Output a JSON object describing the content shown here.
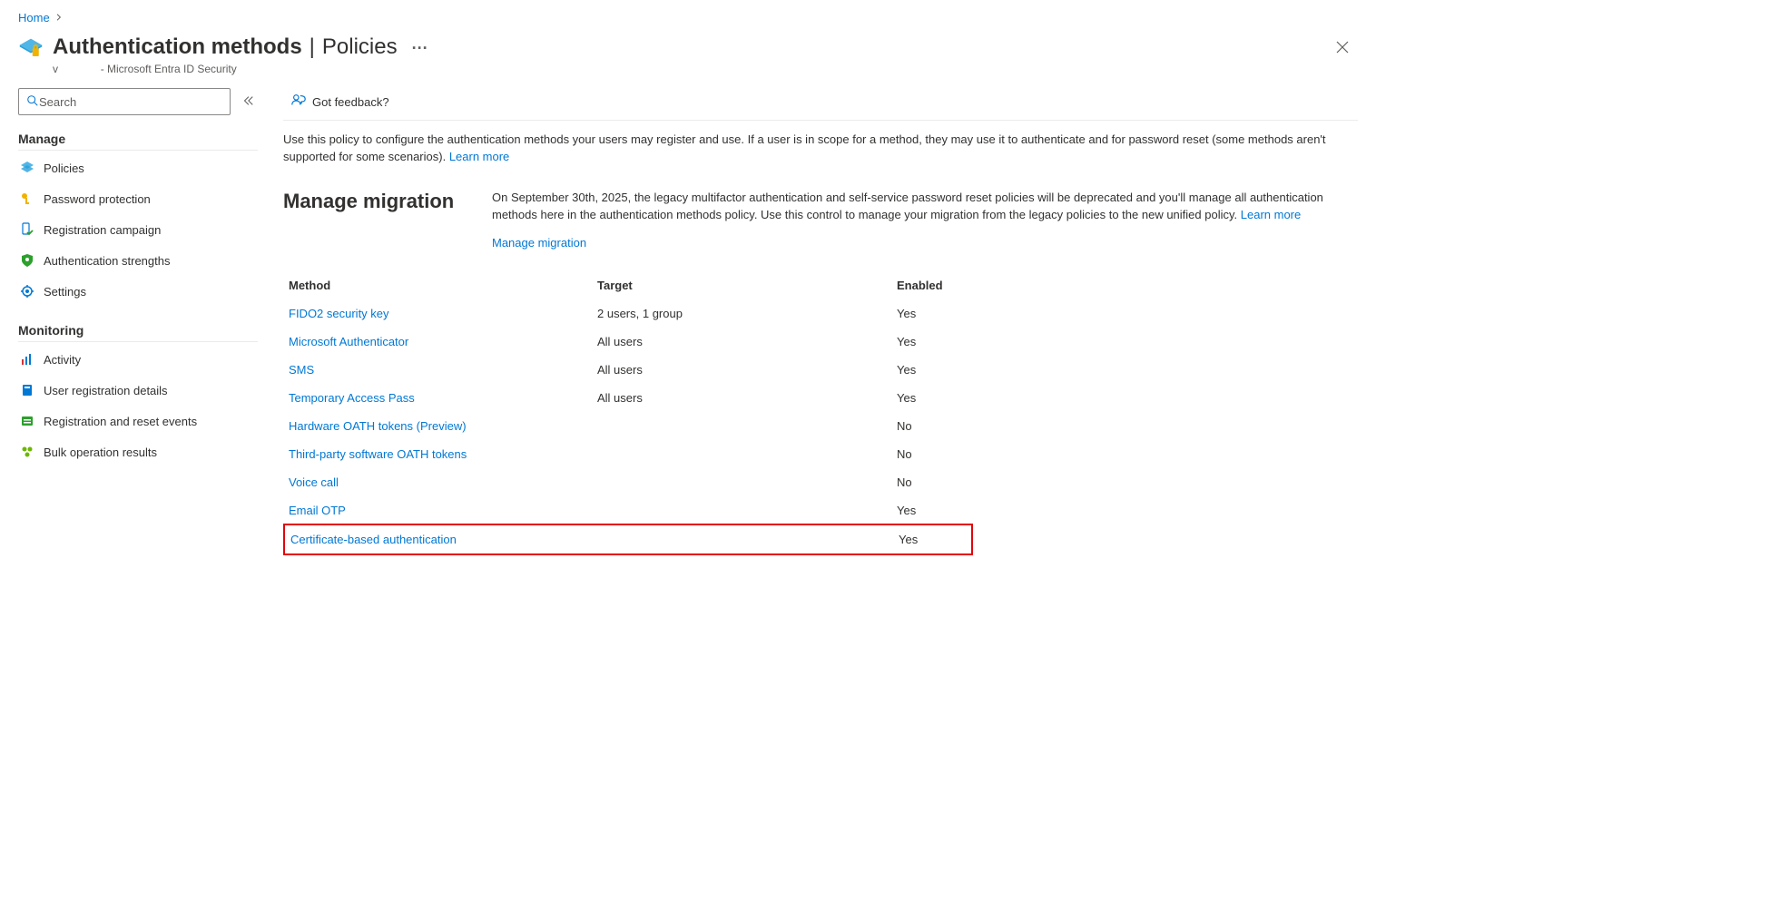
{
  "breadcrumb": {
    "home": "Home"
  },
  "header": {
    "title_strong": "Authentication methods",
    "title_sep": "|",
    "title_light": "Policies",
    "more": "···",
    "subtitle_prefix": "v",
    "subtitle_suffix": "- Microsoft Entra ID Security"
  },
  "sidebar": {
    "search_placeholder": "Search",
    "sections": {
      "manage": {
        "title": "Manage",
        "items": [
          {
            "label": "Policies"
          },
          {
            "label": "Password protection"
          },
          {
            "label": "Registration campaign"
          },
          {
            "label": "Authentication strengths"
          },
          {
            "label": "Settings"
          }
        ]
      },
      "monitoring": {
        "title": "Monitoring",
        "items": [
          {
            "label": "Activity"
          },
          {
            "label": "User registration details"
          },
          {
            "label": "Registration and reset events"
          },
          {
            "label": "Bulk operation results"
          }
        ]
      }
    }
  },
  "toolbar": {
    "feedback": "Got feedback?"
  },
  "description": {
    "text": "Use this policy to configure the authentication methods your users may register and use. If a user is in scope for a method, they may use it to authenticate and for password reset (some methods aren't supported for some scenarios). ",
    "learn_more": "Learn more"
  },
  "migration": {
    "title": "Manage migration",
    "text": "On September 30th, 2025, the legacy multifactor authentication and self-service password reset policies will be deprecated and you'll manage all authentication methods here in the authentication methods policy. Use this control to manage your migration from the legacy policies to the new unified policy. ",
    "learn_more": "Learn more",
    "link": "Manage migration"
  },
  "table": {
    "headers": {
      "method": "Method",
      "target": "Target",
      "enabled": "Enabled"
    },
    "rows": [
      {
        "name": "FIDO2 security key",
        "target": "2 users, 1 group",
        "enabled": "Yes",
        "highlight": false
      },
      {
        "name": "Microsoft Authenticator",
        "target": "All users",
        "enabled": "Yes",
        "highlight": false
      },
      {
        "name": "SMS",
        "target": "All users",
        "enabled": "Yes",
        "highlight": false
      },
      {
        "name": "Temporary Access Pass",
        "target": "All users",
        "enabled": "Yes",
        "highlight": false
      },
      {
        "name": "Hardware OATH tokens (Preview)",
        "target": "",
        "enabled": "No",
        "highlight": false
      },
      {
        "name": "Third-party software OATH tokens",
        "target": "",
        "enabled": "No",
        "highlight": false
      },
      {
        "name": "Voice call",
        "target": "",
        "enabled": "No",
        "highlight": false
      },
      {
        "name": "Email OTP",
        "target": "",
        "enabled": "Yes",
        "highlight": false
      },
      {
        "name": "Certificate-based authentication",
        "target": "",
        "enabled": "Yes",
        "highlight": true
      }
    ]
  }
}
